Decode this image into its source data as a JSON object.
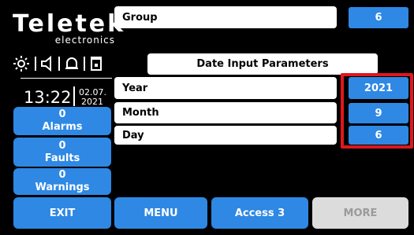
{
  "logo": {
    "name": "Teletek",
    "subtitle": "electronics"
  },
  "status": {
    "icons": [
      "sun-icon",
      "speaker-icon",
      "bell-icon",
      "socket-icon"
    ]
  },
  "clock": {
    "time": "13:22",
    "date_day_month": "02.07.",
    "date_year": "2021"
  },
  "left_panel": {
    "alarms": {
      "count": "0",
      "label": "Alarms"
    },
    "faults": {
      "count": "0",
      "label": "Faults"
    },
    "warnings": {
      "count": "0",
      "label": "Warnings"
    }
  },
  "group": {
    "label": "Group",
    "value": "6"
  },
  "section_title": "Date Input Parameters",
  "fields": {
    "year": {
      "label": "Year",
      "value": "2021"
    },
    "month": {
      "label": "Month",
      "value": "9"
    },
    "day": {
      "label": "Day",
      "value": "6"
    }
  },
  "bottom": {
    "exit": "EXIT",
    "menu": "MENU",
    "access": "Access 3",
    "more": "MORE"
  },
  "colors": {
    "accent": "#2e88e4",
    "highlight": "#e1161c",
    "background": "#000000",
    "disabled": "#dcdcdc"
  }
}
